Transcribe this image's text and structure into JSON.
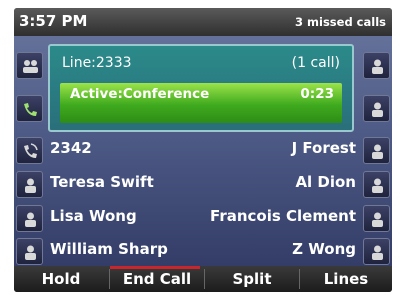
{
  "status": {
    "time": "3:57 PM",
    "missed_calls": "3 missed calls"
  },
  "call": {
    "line": "Line:2333",
    "count": "(1 call)",
    "state": "Active:Conference",
    "duration": "0:23"
  },
  "left_keys": [
    {
      "icon": "multi-user-icon",
      "label": ""
    },
    {
      "icon": "handset-icon",
      "label": ""
    },
    {
      "icon": "handset-ringing-icon",
      "label": "2342"
    },
    {
      "icon": "contact-icon",
      "label": "Teresa Swift"
    },
    {
      "icon": "contact-icon",
      "label": "Lisa Wong"
    },
    {
      "icon": "contact-icon",
      "label": "William Sharp"
    }
  ],
  "right_keys": [
    {
      "icon": "contact-icon",
      "label": ""
    },
    {
      "icon": "contact-icon",
      "label": ""
    },
    {
      "icon": "contact-icon",
      "label": "J Forest"
    },
    {
      "icon": "contact-icon",
      "label": "Al Dion"
    },
    {
      "icon": "contact-icon",
      "label": "Francois Clement"
    },
    {
      "icon": "contact-icon",
      "label": "Z Wong"
    }
  ],
  "softkeys": [
    "Hold",
    "End Call",
    "Split",
    "Lines"
  ],
  "colors": {
    "active_green": "#3faa1e",
    "panel_teal": "#2a7b86",
    "end_call_red": "#c8262c"
  }
}
